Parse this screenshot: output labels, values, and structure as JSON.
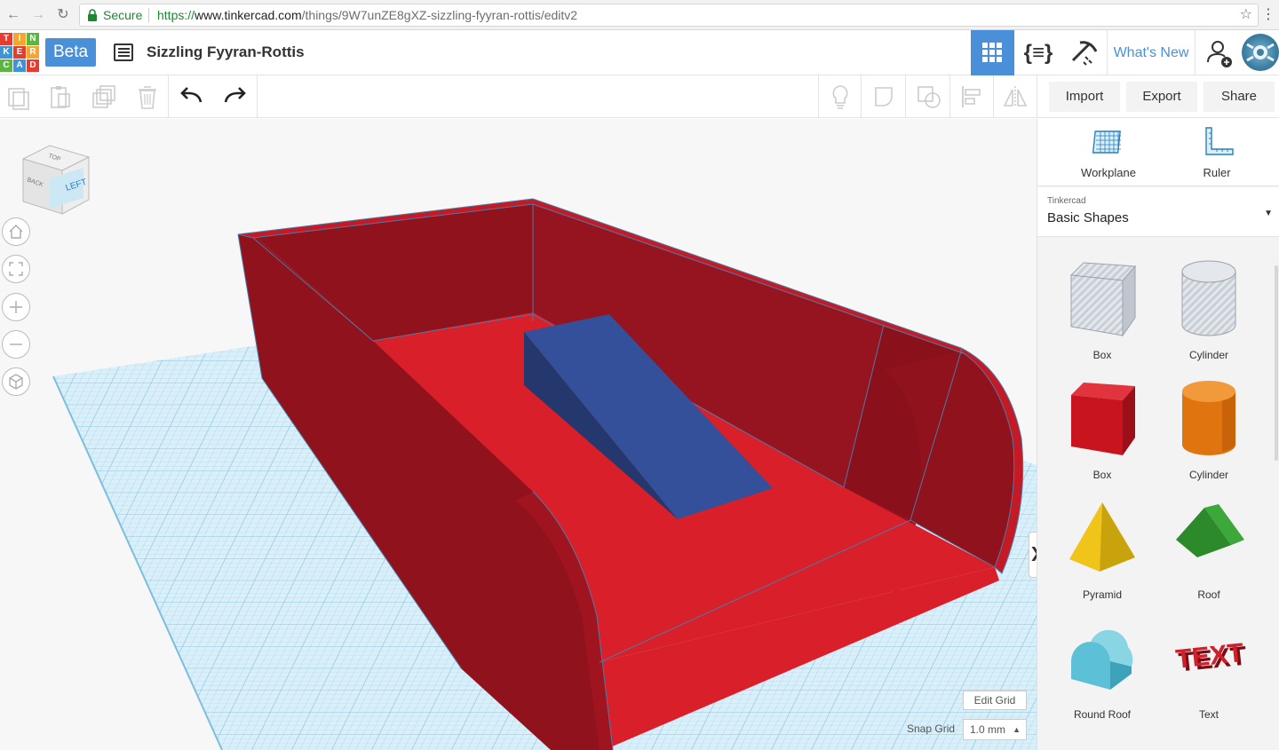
{
  "browser": {
    "secure_label": "Secure",
    "url_scheme": "https://",
    "url_host": "www.tinkercad.com",
    "url_path": "/things/9W7unZE8gXZ-sizzling-fyyran-rottis/editv2"
  },
  "header": {
    "logo_letters": [
      "T",
      "I",
      "N",
      "K",
      "E",
      "R",
      "C",
      "A",
      "D"
    ],
    "beta_label": "Beta",
    "design_title": "Sizzling Fyyran-Rottis",
    "blocks_label": "{≡}",
    "whats_new_label": "What's New"
  },
  "toolbar": {
    "import_label": "Import",
    "export_label": "Export",
    "share_label": "Share"
  },
  "viewcube": {
    "front_face": "LEFT",
    "side_face": "BACK",
    "top_face": "TOP"
  },
  "workspace": {
    "edit_grid_label": "Edit Grid",
    "snap_grid_label": "Snap Grid",
    "snap_grid_value": "1.0 mm",
    "collapse_label": "❯"
  },
  "panel": {
    "workplane_label": "Workplane",
    "ruler_label": "Ruler",
    "category_source": "Tinkercad",
    "category_name": "Basic Shapes",
    "shapes": [
      {
        "label": "Box"
      },
      {
        "label": "Cylinder"
      },
      {
        "label": "Box"
      },
      {
        "label": "Cylinder"
      },
      {
        "label": "Pyramid"
      },
      {
        "label": "Roof"
      },
      {
        "label": "Round Roof"
      },
      {
        "label": "Text"
      }
    ]
  },
  "colors": {
    "accent": "#4a90d9",
    "box_red": "#d81f2a",
    "box_dark_red": "#8f121d",
    "ramp_blue": "#34509a",
    "grid_blue": "#c8e6f4"
  }
}
